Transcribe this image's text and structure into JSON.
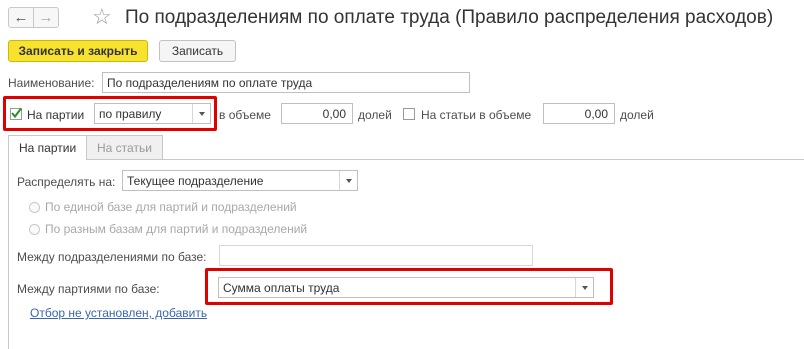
{
  "window": {
    "title": "По подразделениям по оплате труда (Правило распределения расходов)",
    "back_icon": "←",
    "forward_icon": "→",
    "favorite_icon": "☆"
  },
  "toolbar": {
    "save_close_label": "Записать и закрыть",
    "save_label": "Записать"
  },
  "form": {
    "name_label": "Наименование:",
    "name_value": "По подразделениям по оплате труда",
    "batches_checkbox_label": "На партии",
    "batches_checked": true,
    "batches_mode_value": "по правилу",
    "in_volume_label": "в объеме",
    "batches_volume_value": "0,00",
    "shares_label": "долей",
    "items_checkbox_label": "На статьи в объеме",
    "items_checked": false,
    "items_volume_value": "0,00",
    "items_shares_label": "долей"
  },
  "tabs": [
    {
      "label": "На партии",
      "active": true
    },
    {
      "label": "На статьи",
      "active": false
    }
  ],
  "batches_tab": {
    "distribute_label": "Распределять на:",
    "distribute_value": "Текущее подразделение",
    "radio_single_base": "По единой базе для партий и подразделений",
    "radio_different_bases": "По разным базам для партий и подразделений",
    "between_departments_label": "Между подразделениями по базе:",
    "between_departments_value": "",
    "between_batches_label": "Между партиями по базе:",
    "between_batches_value": "Сумма оплаты труда",
    "filter_link": "Отбор не установлен, добавить"
  },
  "colors": {
    "highlight": "#e00000",
    "primary_button": "#f7e230",
    "link": "#3a66b0"
  }
}
